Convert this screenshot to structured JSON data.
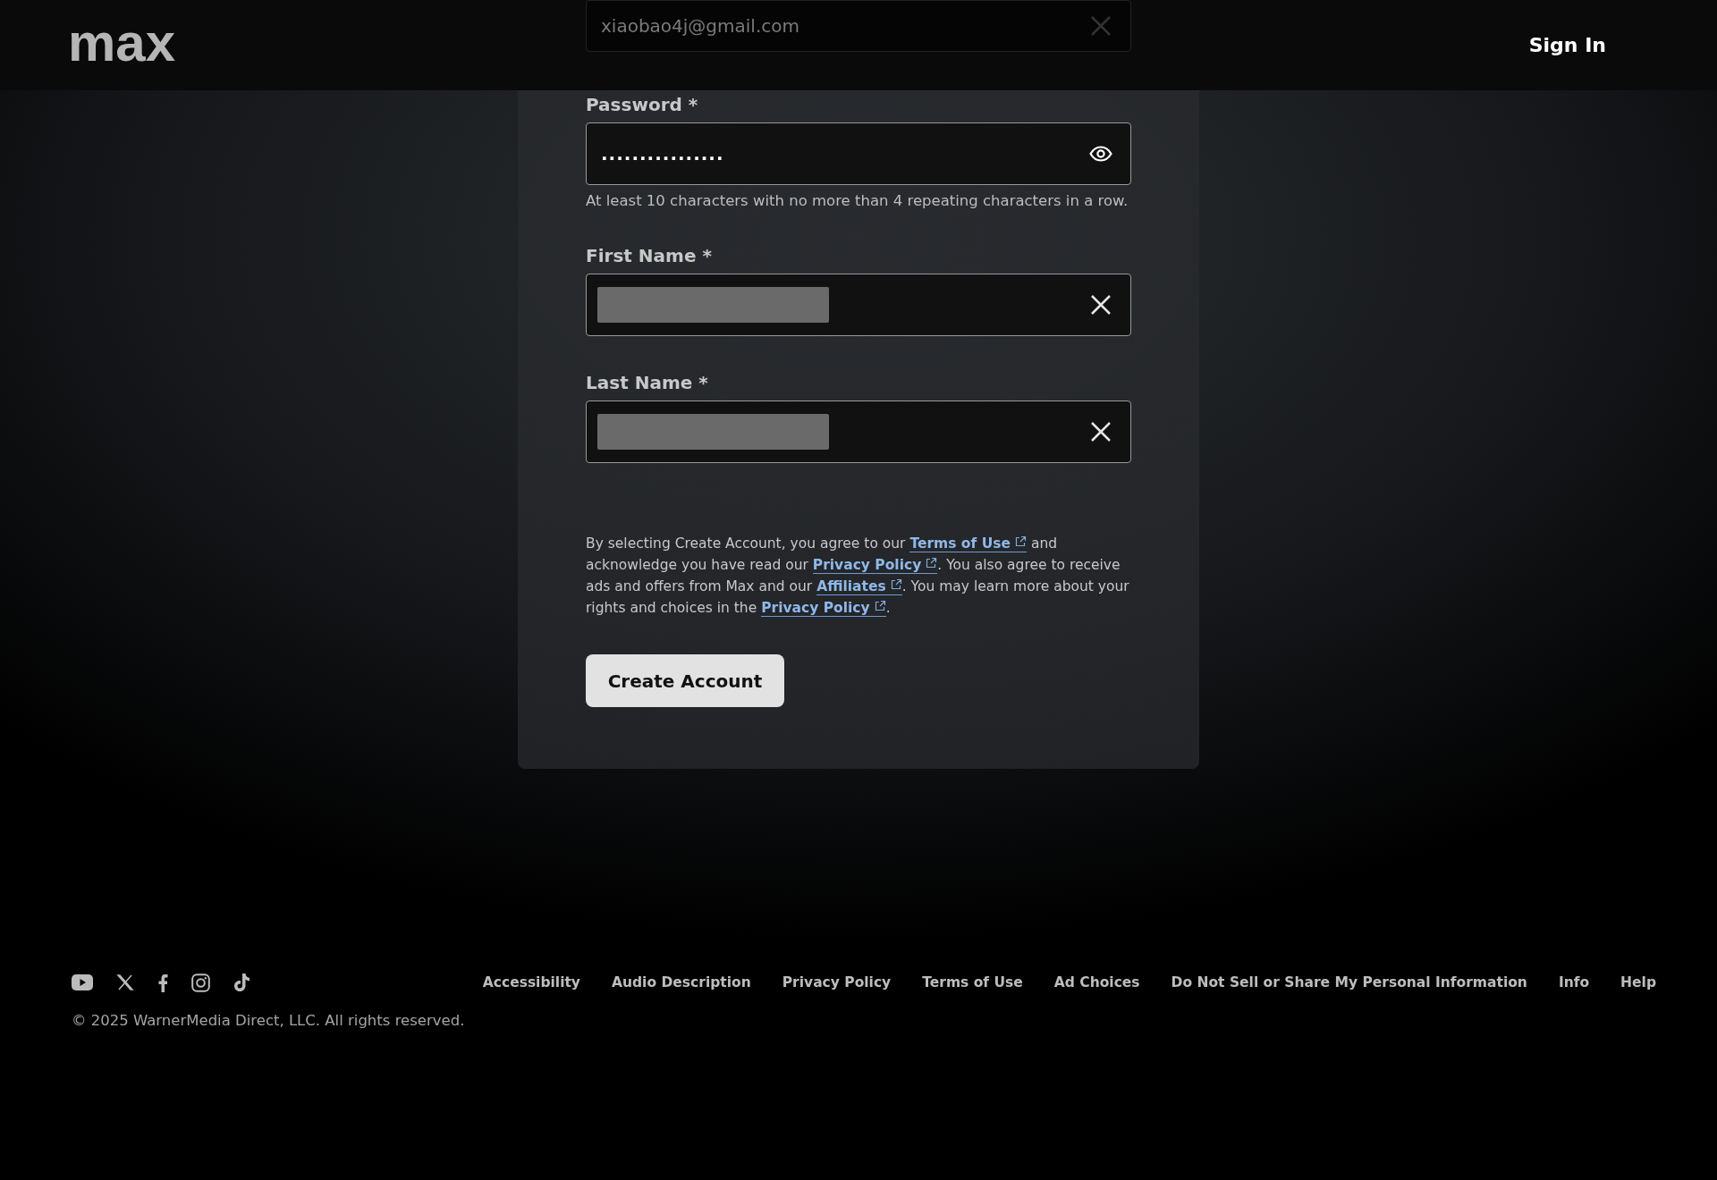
{
  "header": {
    "logo": "max",
    "sign_in": "Sign In"
  },
  "form": {
    "email": {
      "value": "xiaobao4j@gmail.com"
    },
    "password": {
      "label": "Password *",
      "value": "................",
      "hint": "At least 10 characters with no more than 4 repeating characters in a row."
    },
    "first_name": {
      "label": "First Name *"
    },
    "last_name": {
      "label": "Last Name *"
    },
    "legal": [
      {
        "kind": "text",
        "text": "By selecting Create Account, you agree to our "
      },
      {
        "kind": "link",
        "text": "Terms of Use"
      },
      {
        "kind": "text",
        "text": " and acknowledge you have read our "
      },
      {
        "kind": "link",
        "text": "Privacy Policy"
      },
      {
        "kind": "text",
        "text": ". You also agree to receive ads and offers from Max and our "
      },
      {
        "kind": "link",
        "text": "Affiliates"
      },
      {
        "kind": "text",
        "text": ". You may learn more about your rights and choices in the "
      },
      {
        "kind": "link",
        "text": "Privacy Policy"
      },
      {
        "kind": "text",
        "text": "."
      }
    ],
    "submit": "Create Account"
  },
  "footer": {
    "social": [
      {
        "kind": "youtube"
      },
      {
        "kind": "x"
      },
      {
        "kind": "facebook"
      },
      {
        "kind": "instagram"
      },
      {
        "kind": "tiktok"
      }
    ],
    "links": [
      "Accessibility",
      "Audio Description",
      "Privacy Policy",
      "Terms of Use",
      "Ad Choices",
      "Do Not Sell or Share My Personal Information",
      "Info",
      "Help"
    ],
    "copyright": "© 2025 WarnerMedia Direct, LLC. All rights reserved."
  }
}
